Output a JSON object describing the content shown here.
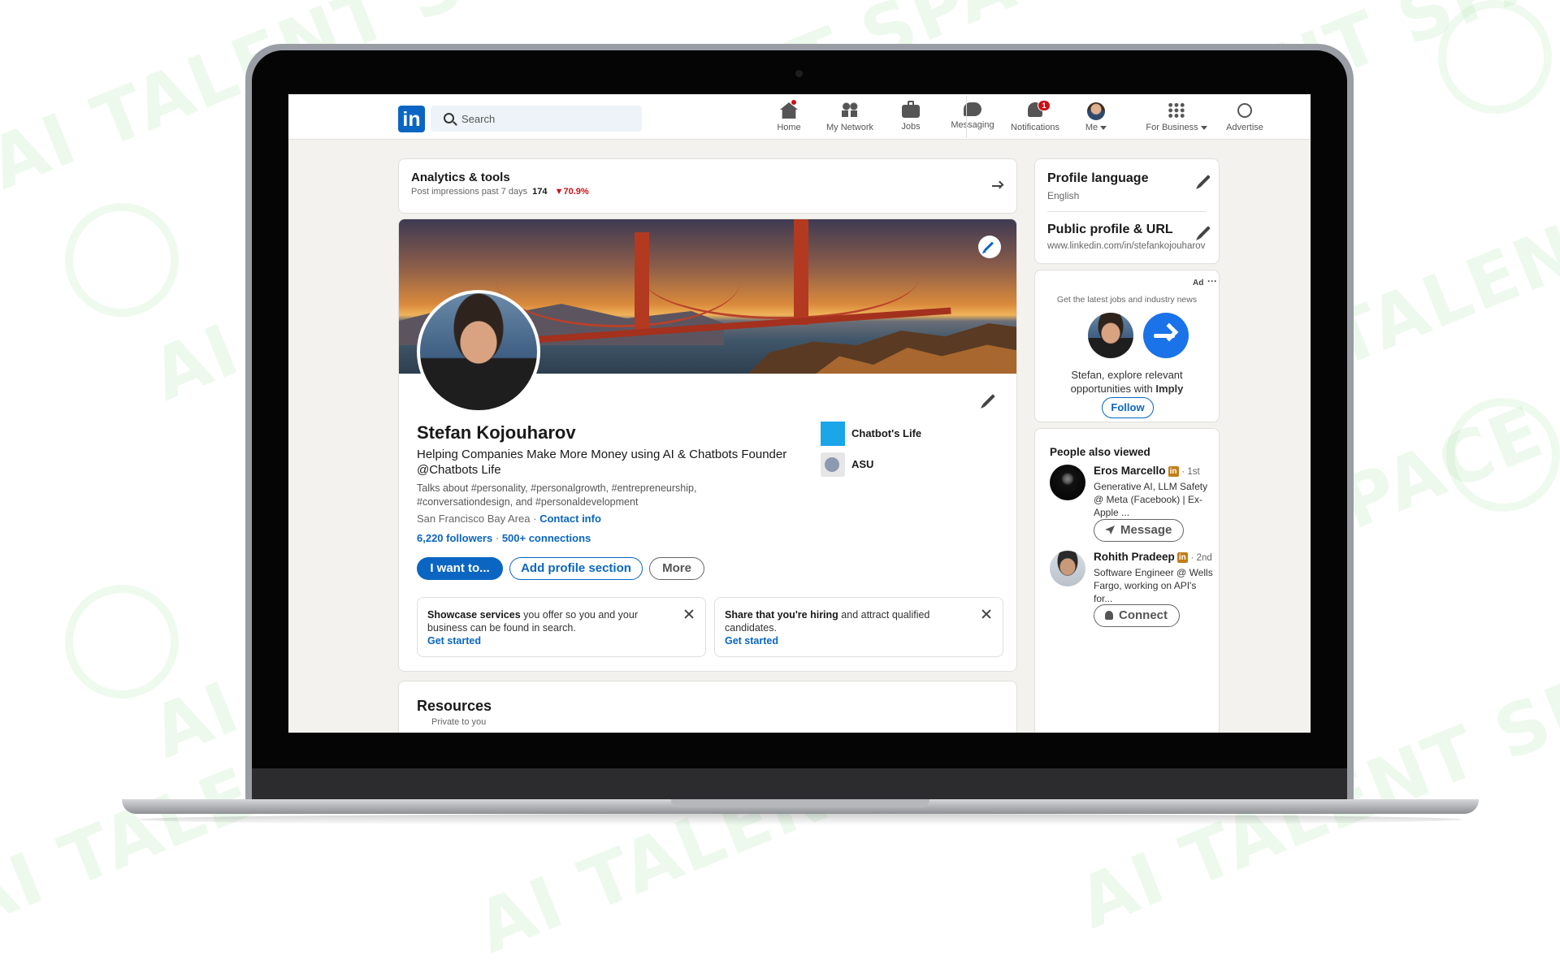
{
  "watermark": {
    "text": "AI TALENT SPACE"
  },
  "nav": {
    "search_placeholder": "Search",
    "items": [
      {
        "label": "Home",
        "icon": "home-icon",
        "badge": ""
      },
      {
        "label": "My Network",
        "icon": "people-icon",
        "badge": ""
      },
      {
        "label": "Jobs",
        "icon": "briefcase-icon",
        "badge": ""
      },
      {
        "label": "Messaging",
        "icon": "chat-icon",
        "badge": ""
      },
      {
        "label": "Notifications",
        "icon": "bell-icon",
        "badge": "1"
      },
      {
        "label": "Me",
        "icon": "avatar-icon",
        "badge": ""
      },
      {
        "label": "For Business",
        "icon": "apps-grid-icon",
        "badge": ""
      },
      {
        "label": "Advertise",
        "icon": "compass-icon",
        "badge": ""
      }
    ]
  },
  "analytics": {
    "title": "Analytics & tools",
    "subtitle_prefix": "Post impressions past 7 days",
    "impressions": "174",
    "change": "▼70.9%"
  },
  "profile": {
    "name": "Stefan Kojouharov",
    "headline": "Helping Companies Make More Money using AI & Chatbots Founder @Chatbots Life",
    "talks_about": "Talks about #personality, #personalgrowth, #entrepreneurship, #conversationdesign, and #personaldevelopment",
    "location": "San Francisco Bay Area",
    "separator": "·",
    "contact_info": "Contact info",
    "followers": "6,220 followers",
    "connections": "500+ connections",
    "orgs": [
      {
        "name": "Chatbot's Life"
      },
      {
        "name": "ASU"
      }
    ],
    "buttons": {
      "i_want_to": "I want to...",
      "add_section": "Add profile section",
      "more": "More"
    }
  },
  "suggestions": [
    {
      "bold": "Showcase services",
      "rest": " you offer so you and your business can be found in search.",
      "cta": "Get started"
    },
    {
      "bold": "Share that you're hiring",
      "rest": " and attract qualified candidates.",
      "cta": "Get started"
    }
  ],
  "resources": {
    "title": "Resources",
    "subtitle": "Private to you"
  },
  "sidebar": {
    "profile_language": {
      "title": "Profile language",
      "value": "English"
    },
    "public_profile": {
      "title": "Public profile & URL",
      "value": "www.linkedin.com/in/stefankojouharov"
    },
    "ad": {
      "label": "Ad",
      "tagline": "Get the latest jobs and industry news",
      "message": "Stefan, explore relevant opportunities with",
      "brand": "Imply",
      "follow": "Follow"
    },
    "people_also_viewed": {
      "title": "People also viewed",
      "people": [
        {
          "name": "Eros Marcello",
          "degree": "· 1st",
          "headline": "Generative AI, LLM Safety @ Meta (Facebook) | Ex-Apple ...",
          "action": "Message"
        },
        {
          "name": "Rohith Pradeep",
          "degree": "· 2nd",
          "headline": "Software Engineer @ Wells Fargo, working on API's for...",
          "action": "Connect"
        }
      ]
    }
  },
  "colors": {
    "brand": "#0a66c2",
    "badge": "#cc1016",
    "negative": "#cc1016",
    "background": "#f4f2ee"
  }
}
